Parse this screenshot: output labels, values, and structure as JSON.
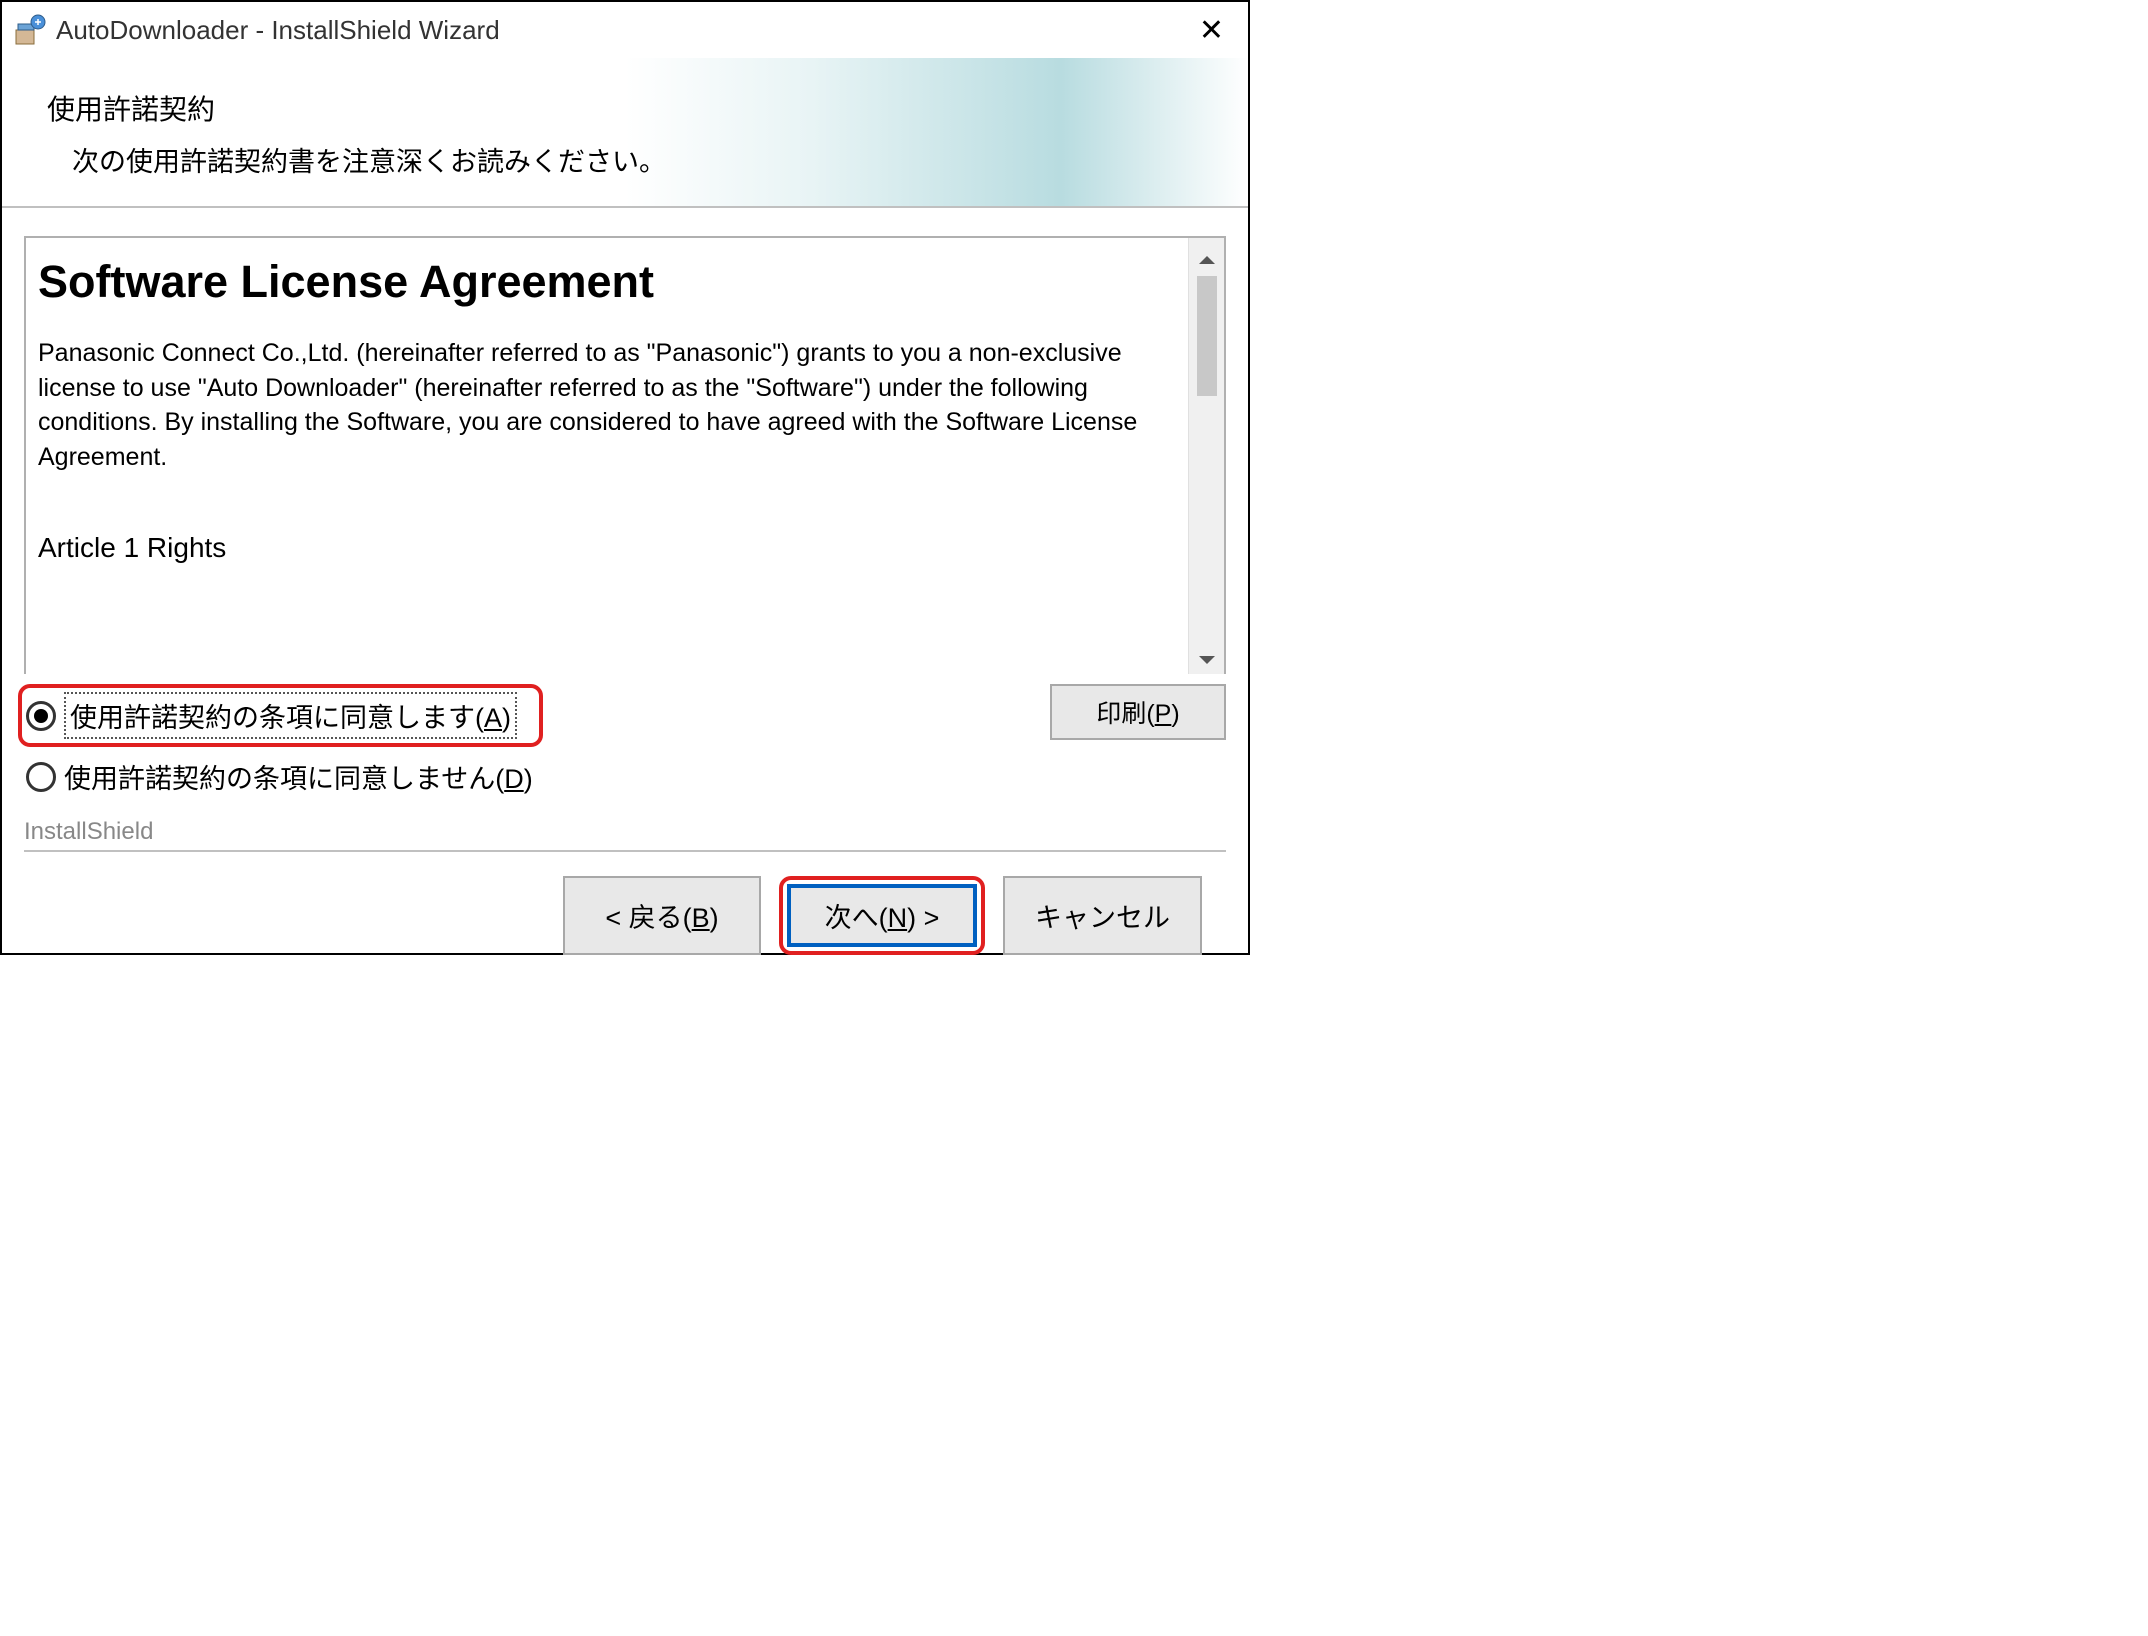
{
  "window": {
    "title": "AutoDownloader - InstallShield Wizard"
  },
  "header": {
    "title": "使用許諾契約",
    "subtitle": "次の使用許諾契約書を注意深くお読みください。"
  },
  "license": {
    "heading": "Software License Agreement",
    "body": "Panasonic Connect Co.,Ltd. (hereinafter referred to as \"Panasonic\") grants to you a non-exclusive license to use \"Auto Downloader\" (hereinafter referred to as the \"Software\") under the following conditions.\nBy installing the Software, you are considered to have agreed with the Software License Agreement.",
    "article": "Article 1 Rights"
  },
  "radios": {
    "accept_prefix": "使用許諾契約の条項に同意します(",
    "accept_key": "A",
    "accept_suffix": ")",
    "decline_prefix": "使用許諾契約の条項に同意しません(",
    "decline_key": "D",
    "decline_suffix": ")"
  },
  "buttons": {
    "print_prefix": "印刷(",
    "print_key": "P",
    "print_suffix": ")",
    "back_prefix": "< 戻る(",
    "back_key": "B",
    "back_suffix": ")",
    "next_prefix": "次へ(",
    "next_key": "N",
    "next_suffix": ") >",
    "cancel": "キャンセル"
  },
  "footer": {
    "brand": "InstallShield"
  }
}
